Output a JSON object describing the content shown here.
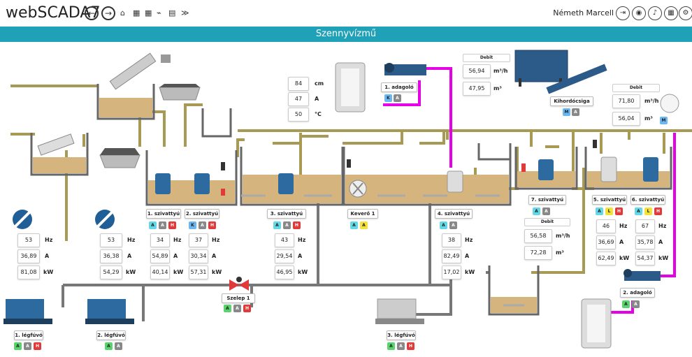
{
  "app": {
    "title": "webSCADA7",
    "user": "Németh Marcell"
  },
  "page": {
    "title": "Szennyvízmű"
  },
  "sensors": {
    "level": "84",
    "level_unit": "cm",
    "current": "47",
    "current_unit": "A",
    "temp": "50",
    "temp_unit": "°C"
  },
  "fan1": {
    "hz": "53",
    "a": "36,89",
    "kw": "81,08",
    "label": "1. légfúvó"
  },
  "fan2": {
    "hz": "53",
    "a": "36,38",
    "kw": "54,29",
    "label": "2. légfúvó"
  },
  "fan3": {
    "label": "3. légfúvó"
  },
  "pump1": {
    "label": "1. szivattyú",
    "hz": "34",
    "a": "54,89",
    "kw": "40,14"
  },
  "pump2": {
    "label": "2. szivattyú",
    "hz": "37",
    "a": "30,34",
    "kw": "57,31"
  },
  "pump3": {
    "label": "3. szivattyú",
    "hz": "43",
    "a": "29,54",
    "kw": "46,95"
  },
  "mixer1": {
    "label": "Keverő 1"
  },
  "pump4": {
    "label": "4. szivattyú",
    "hz": "38",
    "a": "82,49",
    "kw": "17,02"
  },
  "pump5": {
    "label": "5. szivattyú",
    "hz": "46",
    "a": "36,69",
    "kw": "62,49"
  },
  "pump6": {
    "label": "6. szivattyú",
    "hz": "67",
    "a": "35,78",
    "kw": "54,37"
  },
  "pump7": {
    "label": "7. szivattyú"
  },
  "valve1": {
    "label": "Szelep 1"
  },
  "doser1": {
    "label": "1. adagoló"
  },
  "doser2": {
    "label": "2. adagoló"
  },
  "conveyor": {
    "label": "Kihordócsiga"
  },
  "debit1": {
    "title": "Debit",
    "flow": "56,94",
    "flow_unit": "m³/h",
    "total": "47,95",
    "total_unit": "m³"
  },
  "debit2": {
    "title": "Debit",
    "flow": "71,80",
    "flow_unit": "m³/h",
    "total": "56,04",
    "total_unit": "m³"
  },
  "debit3": {
    "title": "Debit",
    "flow": "56,58",
    "flow_unit": "m³/h",
    "total": "72,28",
    "total_unit": "m³"
  },
  "units": {
    "hz": "Hz",
    "a": "A",
    "kw": "kW"
  },
  "badges": {
    "A": "A",
    "H": "H",
    "K": "K",
    "L": "L",
    "M": "M"
  },
  "colors": {
    "accent": "#1fa1b8",
    "pipe": "#a89a55",
    "magenta": "#e600e6",
    "sludge": "#d6b47d"
  }
}
